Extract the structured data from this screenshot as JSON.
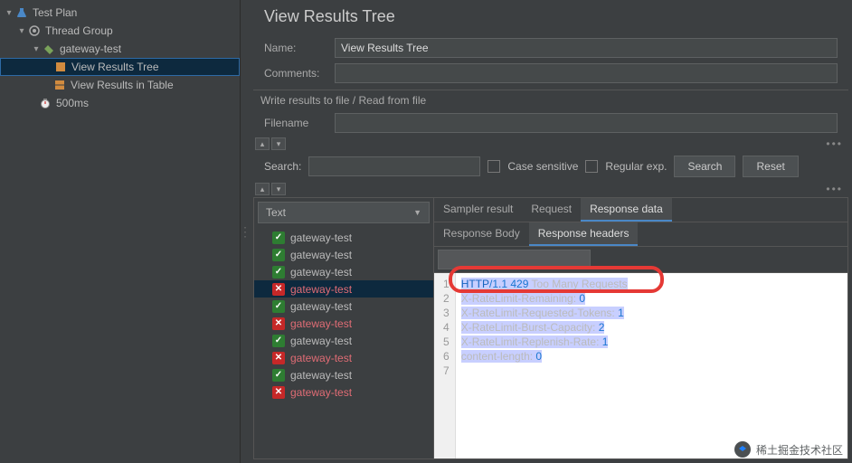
{
  "tree": {
    "root": "Test Plan",
    "thread_group": "Thread Group",
    "gateway_test": "gateway-test",
    "view_results_tree": "View Results Tree",
    "view_results_table": "View Results in Table",
    "timer": "500ms"
  },
  "panel": {
    "title": "View Results Tree",
    "name_label": "Name:",
    "name_value": "View Results Tree",
    "comments_label": "Comments:",
    "comments_value": "",
    "file_section": "Write results to file / Read from file",
    "filename_label": "Filename",
    "filename_value": ""
  },
  "search_bar": {
    "label": "Search:",
    "value": "",
    "case_sensitive": "Case sensitive",
    "regex": "Regular exp.",
    "search_btn": "Search",
    "reset_btn": "Reset"
  },
  "results": {
    "renderer": "Text",
    "items": [
      {
        "label": "gateway-test",
        "ok": true,
        "sel": false
      },
      {
        "label": "gateway-test",
        "ok": true,
        "sel": false
      },
      {
        "label": "gateway-test",
        "ok": true,
        "sel": false
      },
      {
        "label": "gateway-test",
        "ok": false,
        "sel": true
      },
      {
        "label": "gateway-test",
        "ok": true,
        "sel": false
      },
      {
        "label": "gateway-test",
        "ok": false,
        "sel": false
      },
      {
        "label": "gateway-test",
        "ok": true,
        "sel": false
      },
      {
        "label": "gateway-test",
        "ok": false,
        "sel": false
      },
      {
        "label": "gateway-test",
        "ok": true,
        "sel": false
      },
      {
        "label": "gateway-test",
        "ok": false,
        "sel": false
      }
    ]
  },
  "tabs": {
    "sampler_result": "Sampler result",
    "request": "Request",
    "response_data": "Response data",
    "response_body": "Response Body",
    "response_headers": "Response headers"
  },
  "response_headers": {
    "lines": [
      {
        "n": 1,
        "protocol": "HTTP",
        "ver": "/1.1 429 ",
        "rest": "Too Many Requests"
      },
      {
        "n": 2,
        "key": "X-RateLimit-Remaining: ",
        "val": "0"
      },
      {
        "n": 3,
        "key": "X-RateLimit-Requested-Tokens: ",
        "val": "1"
      },
      {
        "n": 4,
        "key": "X-RateLimit-Burst-Capacity: ",
        "val": "2"
      },
      {
        "n": 5,
        "key": "X-RateLimit-Replenish-Rate: ",
        "val": "1"
      },
      {
        "n": 6,
        "key": "content-length: ",
        "val": "0"
      },
      {
        "n": 7,
        "key": "",
        "val": ""
      }
    ]
  },
  "watermark": "稀土掘金技术社区"
}
